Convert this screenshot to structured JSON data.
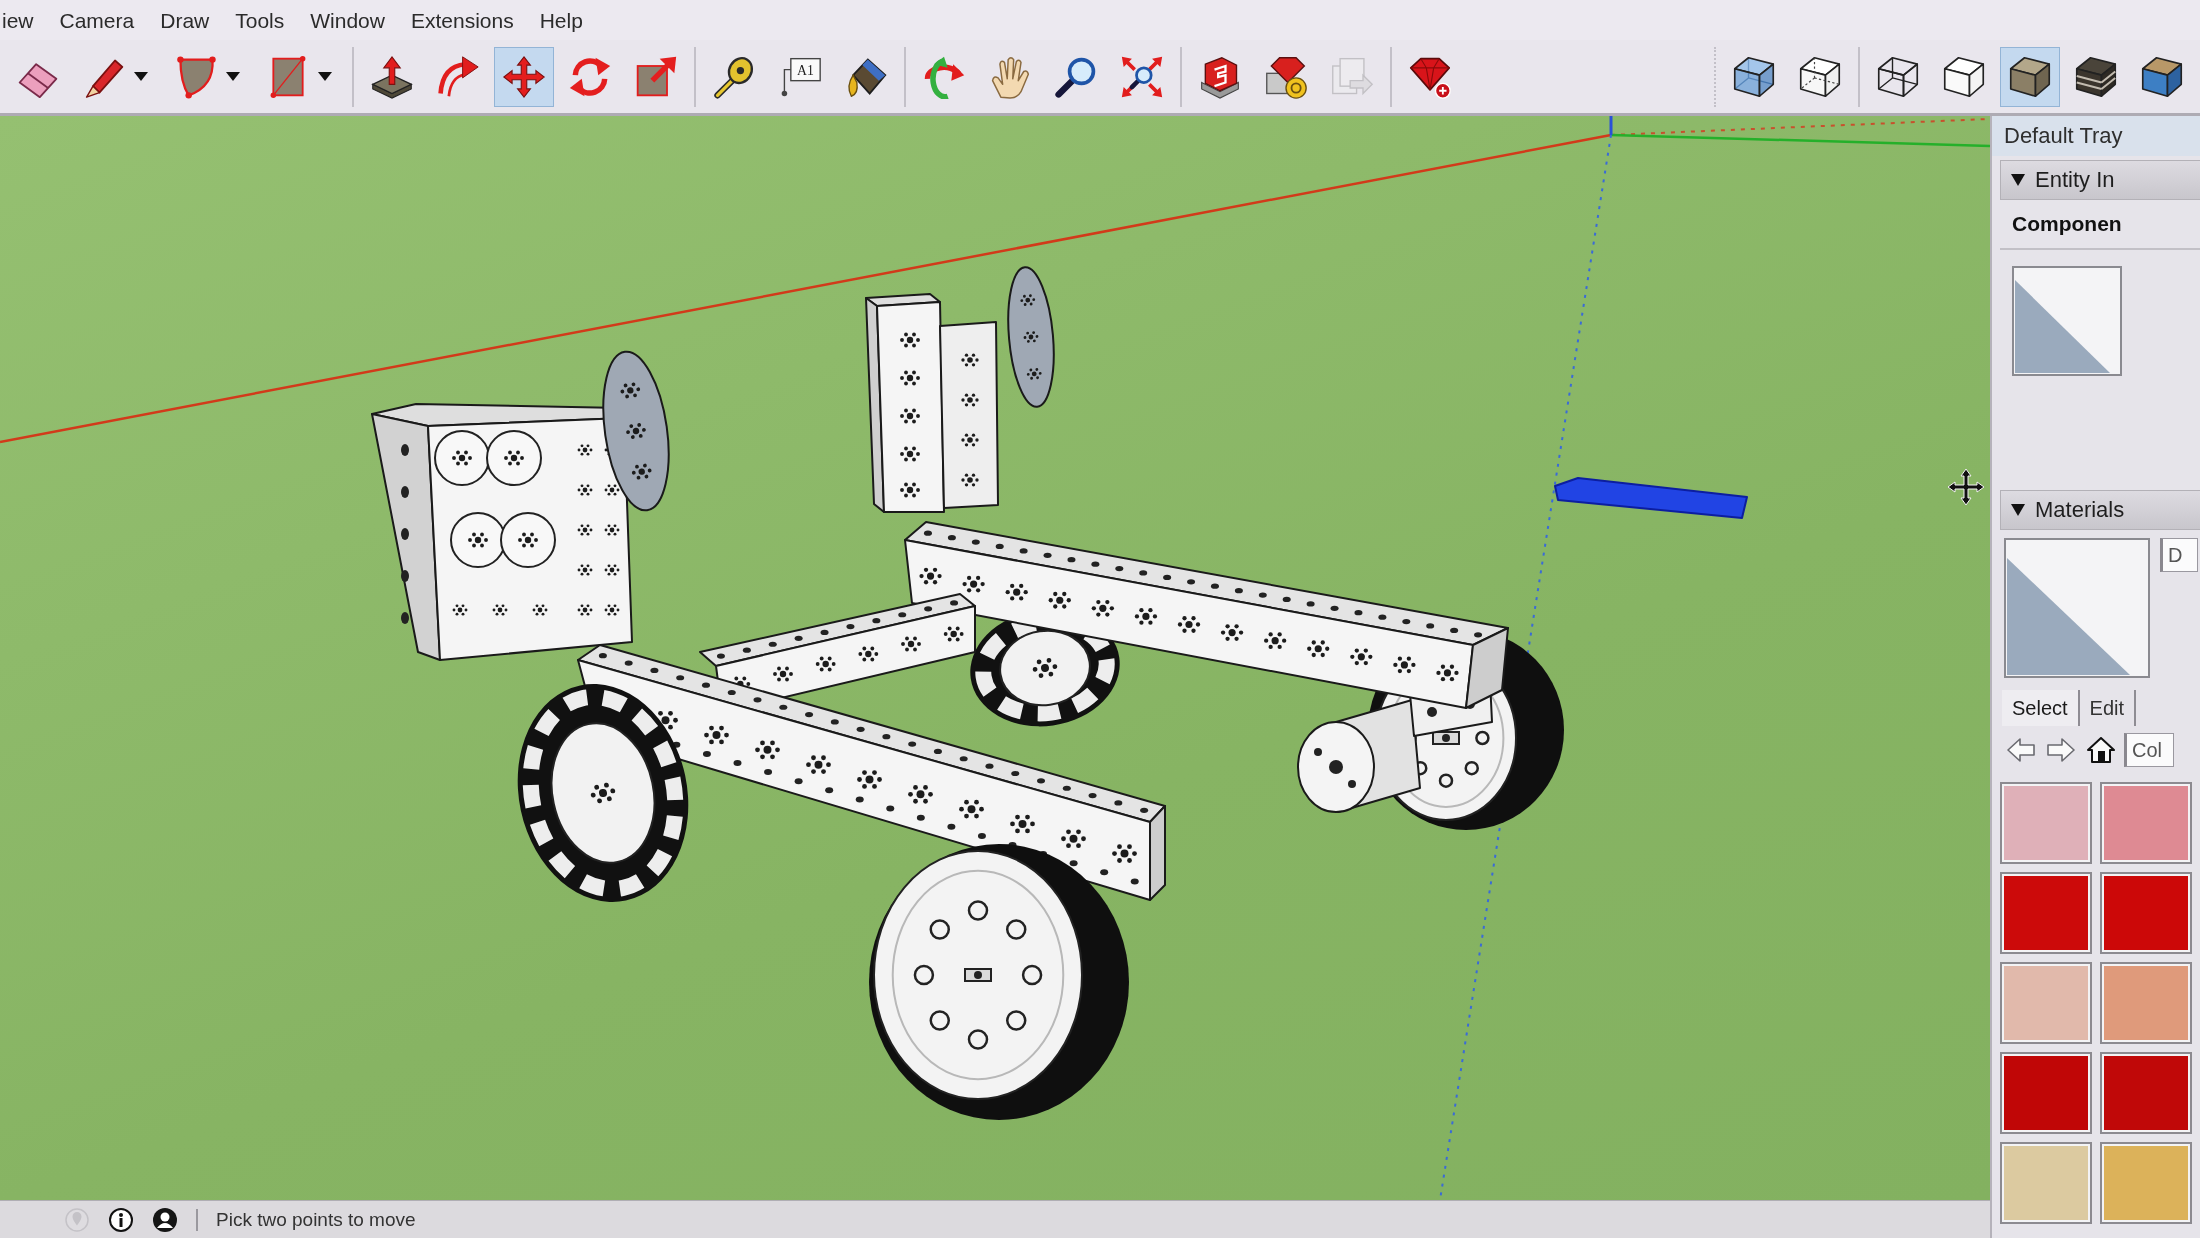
{
  "menu": [
    "iew",
    "Camera",
    "Draw",
    "Tools",
    "Window",
    "Extensions",
    "Help"
  ],
  "toolbar": {
    "groups": [
      {
        "tools": [
          {
            "kind": "eraser",
            "selected": false,
            "dropdown": false,
            "disabled": false
          },
          {
            "kind": "pencil",
            "selected": false,
            "dropdown": true,
            "disabled": false
          },
          {
            "kind": "arc",
            "selected": false,
            "dropdown": true,
            "disabled": false
          },
          {
            "kind": "rectangle",
            "selected": false,
            "dropdown": true,
            "disabled": false
          }
        ]
      },
      {
        "tools": [
          {
            "kind": "push_pull",
            "selected": false,
            "dropdown": false,
            "disabled": false
          },
          {
            "kind": "follow_me",
            "selected": false,
            "dropdown": false,
            "disabled": false
          },
          {
            "kind": "move",
            "selected": true,
            "dropdown": false,
            "disabled": false
          },
          {
            "kind": "rotate",
            "selected": false,
            "dropdown": false,
            "disabled": false
          },
          {
            "kind": "scale",
            "selected": false,
            "dropdown": false,
            "disabled": false
          }
        ]
      },
      {
        "tools": [
          {
            "kind": "tape_measure",
            "selected": false,
            "dropdown": false,
            "disabled": false
          },
          {
            "kind": "text",
            "glyph": "A1",
            "selected": false,
            "dropdown": false,
            "disabled": false
          },
          {
            "kind": "paint_bucket",
            "selected": false,
            "dropdown": false,
            "disabled": false
          }
        ]
      },
      {
        "tools": [
          {
            "kind": "orbit",
            "selected": false,
            "dropdown": false,
            "disabled": false
          },
          {
            "kind": "pan",
            "selected": false,
            "dropdown": false,
            "disabled": false
          },
          {
            "kind": "zoom",
            "selected": false,
            "dropdown": false,
            "disabled": false
          },
          {
            "kind": "zoom_extents",
            "selected": false,
            "dropdown": false,
            "disabled": false
          }
        ]
      },
      {
        "tools": [
          {
            "kind": "warehouse",
            "selected": false,
            "dropdown": false,
            "disabled": false
          },
          {
            "kind": "extension_warehouse",
            "selected": false,
            "dropdown": false,
            "disabled": false
          },
          {
            "kind": "layout",
            "selected": false,
            "dropdown": false,
            "disabled": true
          }
        ]
      },
      {
        "tools": [
          {
            "kind": "ruby_console",
            "selected": false,
            "dropdown": false,
            "disabled": false
          }
        ]
      }
    ]
  },
  "style_toolbar": {
    "groups": [
      {
        "tools": [
          {
            "kind": "xray",
            "selected": false,
            "dropdown": false,
            "disabled": false
          },
          {
            "kind": "back_edges",
            "selected": false,
            "dropdown": false,
            "disabled": false
          }
        ]
      },
      {
        "tools": [
          {
            "kind": "wireframe",
            "selected": false,
            "dropdown": false,
            "disabled": false
          },
          {
            "kind": "hidden_line",
            "selected": false,
            "dropdown": false,
            "disabled": false
          },
          {
            "kind": "shaded",
            "selected": true,
            "dropdown": false,
            "disabled": false
          },
          {
            "kind": "shaded_textures",
            "selected": false,
            "dropdown": false,
            "disabled": false
          },
          {
            "kind": "monochrome",
            "selected": false,
            "dropdown": false,
            "disabled": false
          }
        ]
      }
    ]
  },
  "tray": {
    "title": "Default Tray",
    "panels": [
      {
        "kind": "entity_info",
        "title": "Entity In",
        "expanded": true,
        "heading": "Componen"
      },
      {
        "kind": "materials",
        "title": "Materials",
        "expanded": true,
        "name_field": "D",
        "tabs": [
          {
            "label": "Select",
            "selected": true
          },
          {
            "label": "Edit",
            "selected": false
          }
        ],
        "collection_field": "Col",
        "swatches": [
          {
            "color": "#dfb0b8"
          },
          {
            "color": "#de8a93"
          },
          {
            "color": "#cc0a0a"
          },
          {
            "color": "#cc0808"
          },
          {
            "color": "#e1b9ab"
          },
          {
            "color": "#df9a7b"
          },
          {
            "color": "#c00606"
          },
          {
            "color": "#c00808"
          },
          {
            "color": "#dccaa0"
          },
          {
            "color": "#dcb25a"
          }
        ]
      }
    ]
  },
  "status_bar": {
    "icons": [
      {
        "kind": "geo_location",
        "disabled": true
      },
      {
        "kind": "info",
        "disabled": false
      },
      {
        "kind": "credits",
        "disabled": false
      }
    ],
    "message": "Pick two points to move"
  }
}
